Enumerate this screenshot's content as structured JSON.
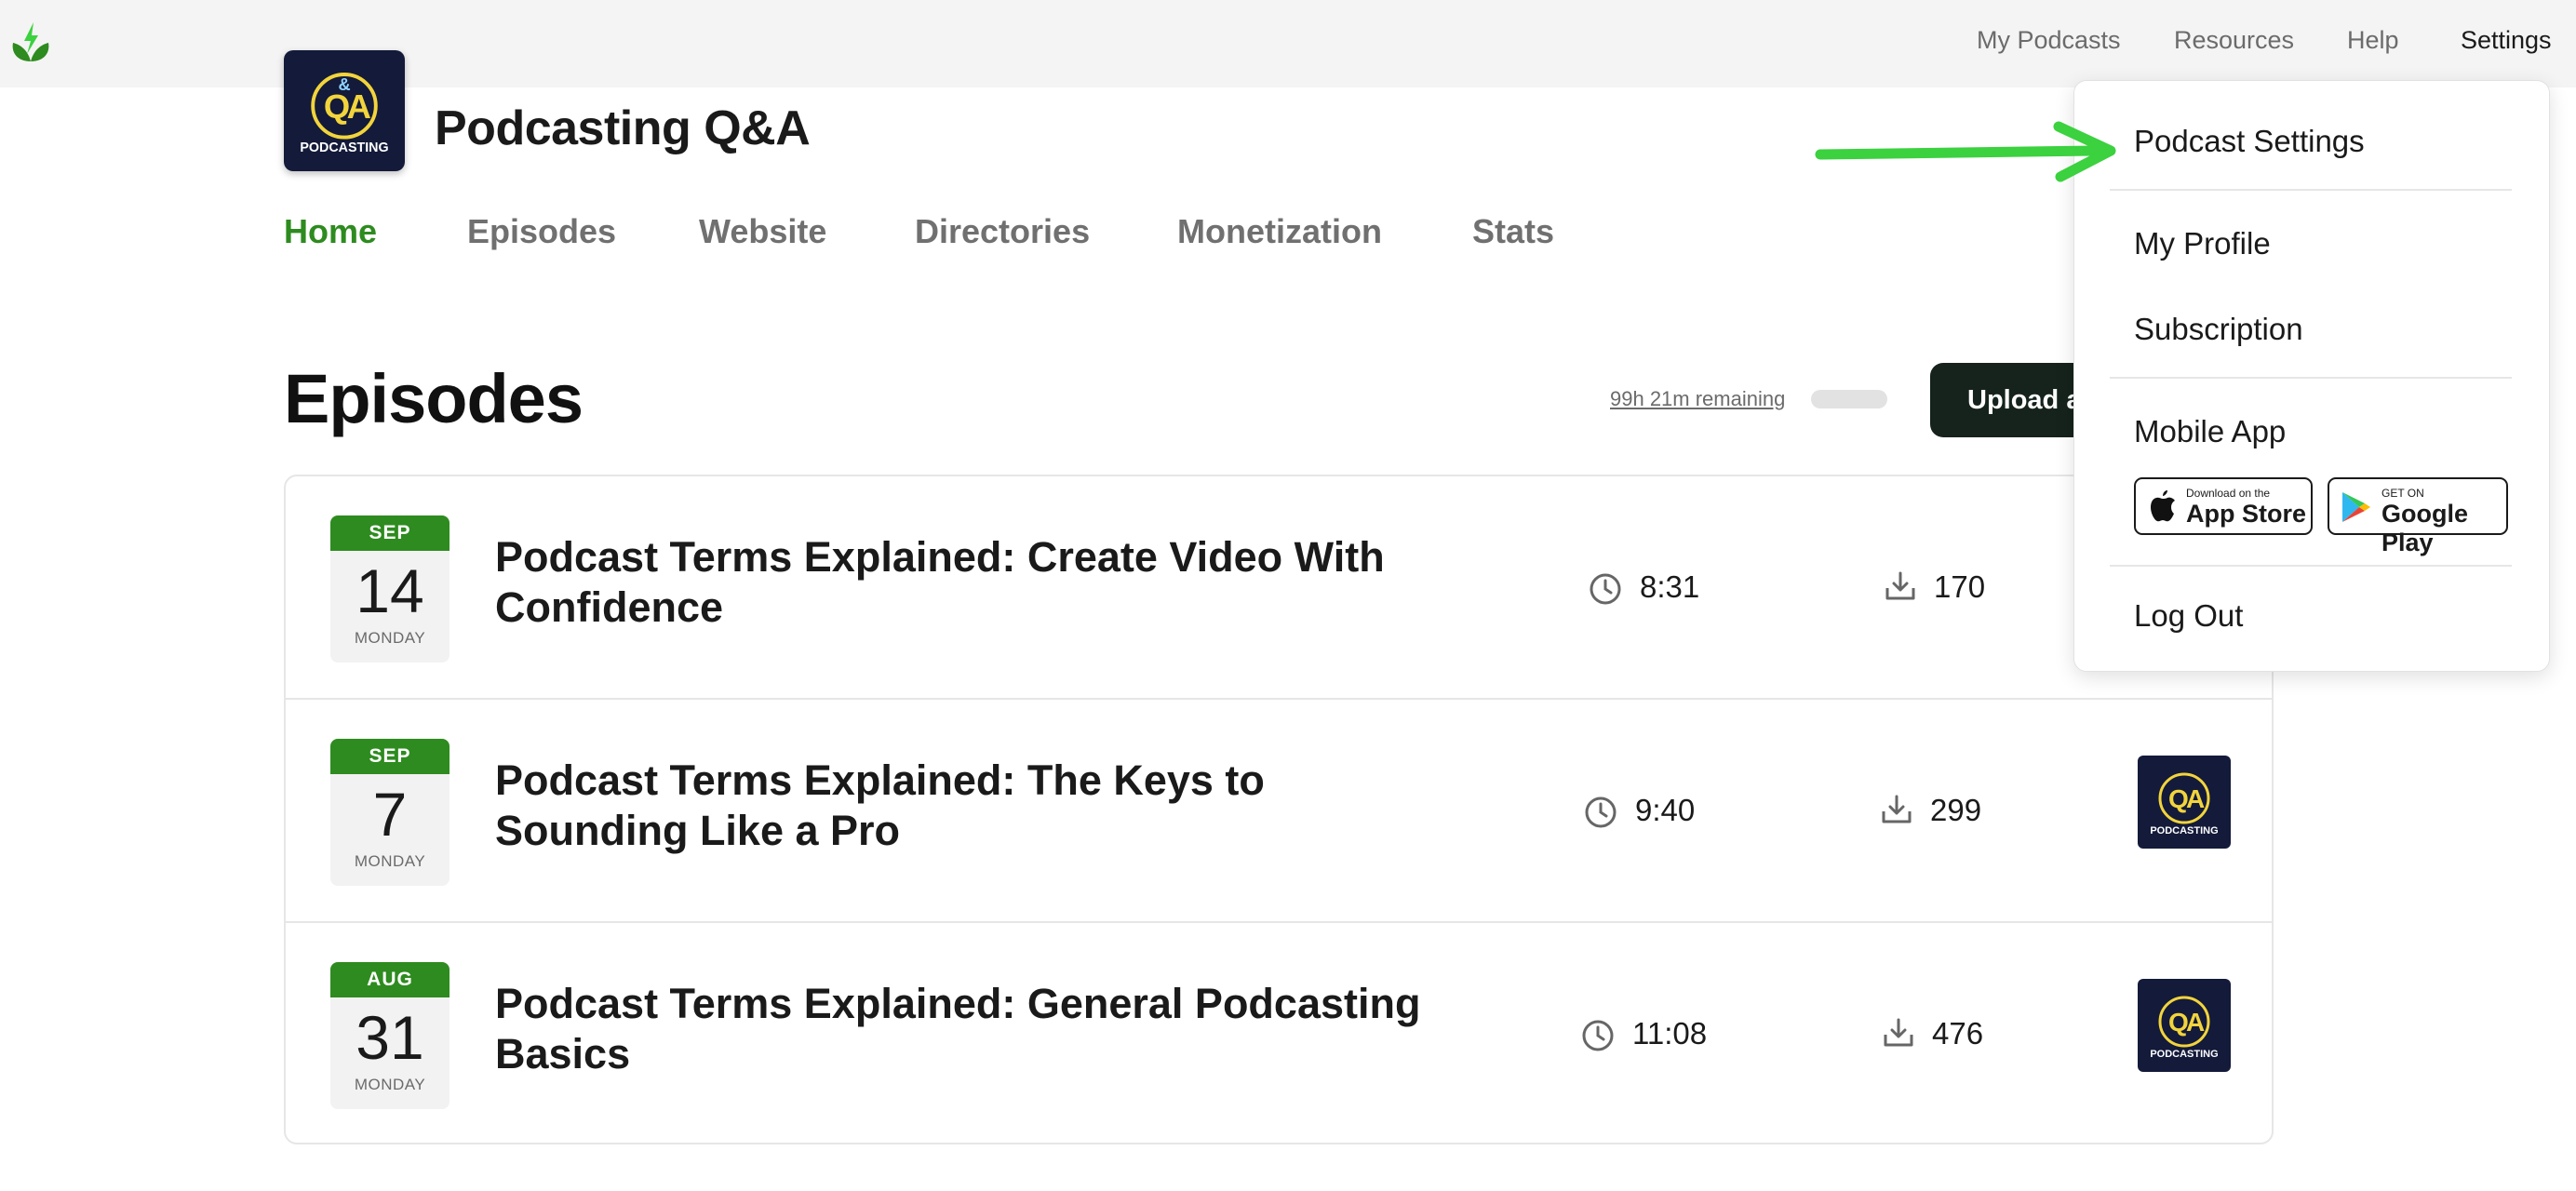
{
  "topbar": {
    "nav": [
      "My Podcasts",
      "Resources",
      "Help",
      "Settings"
    ]
  },
  "podcast": {
    "title": "Podcasting Q&A",
    "cover_text": "PODCASTING"
  },
  "tabs": [
    "Home",
    "Episodes",
    "Website",
    "Directories",
    "Monetization",
    "Stats"
  ],
  "episodes": {
    "heading": "Episodes",
    "remaining": "99h 21m remaining",
    "storage_used_fraction": 0.0,
    "upload_label": "Upload a",
    "items": [
      {
        "month": "SEP",
        "day": "14",
        "weekday": "MONDAY",
        "title": "Podcast Terms Explained: Create Video With Confidence",
        "duration": "8:31",
        "downloads": "170"
      },
      {
        "month": "SEP",
        "day": "7",
        "weekday": "MONDAY",
        "title": "Podcast Terms Explained: The Keys to Sounding Like a Pro",
        "duration": "9:40",
        "downloads": "299"
      },
      {
        "month": "AUG",
        "day": "31",
        "weekday": "MONDAY",
        "title": "Podcast Terms Explained: General Podcasting Basics",
        "duration": "11:08",
        "downloads": "476"
      }
    ]
  },
  "settings_menu": {
    "podcast_settings": "Podcast Settings",
    "my_profile": "My Profile",
    "subscription": "Subscription",
    "mobile_app": "Mobile App",
    "app_store_top": "Download on the",
    "app_store_main": "App Store",
    "google_play_top": "GET ON",
    "google_play_main": "Google Play",
    "log_out": "Log Out"
  },
  "colors": {
    "brand_green": "#2e8b1f",
    "arrow_green": "#3bd13f",
    "upload_button": "#15231c",
    "cover_background": "#131a3a",
    "cover_accent": "#f2d43c"
  },
  "icons": [
    "buzzsprout-logo-icon",
    "clock-icon",
    "download-icon",
    "apple-icon",
    "google-play-icon",
    "arrow-pointer-icon"
  ]
}
